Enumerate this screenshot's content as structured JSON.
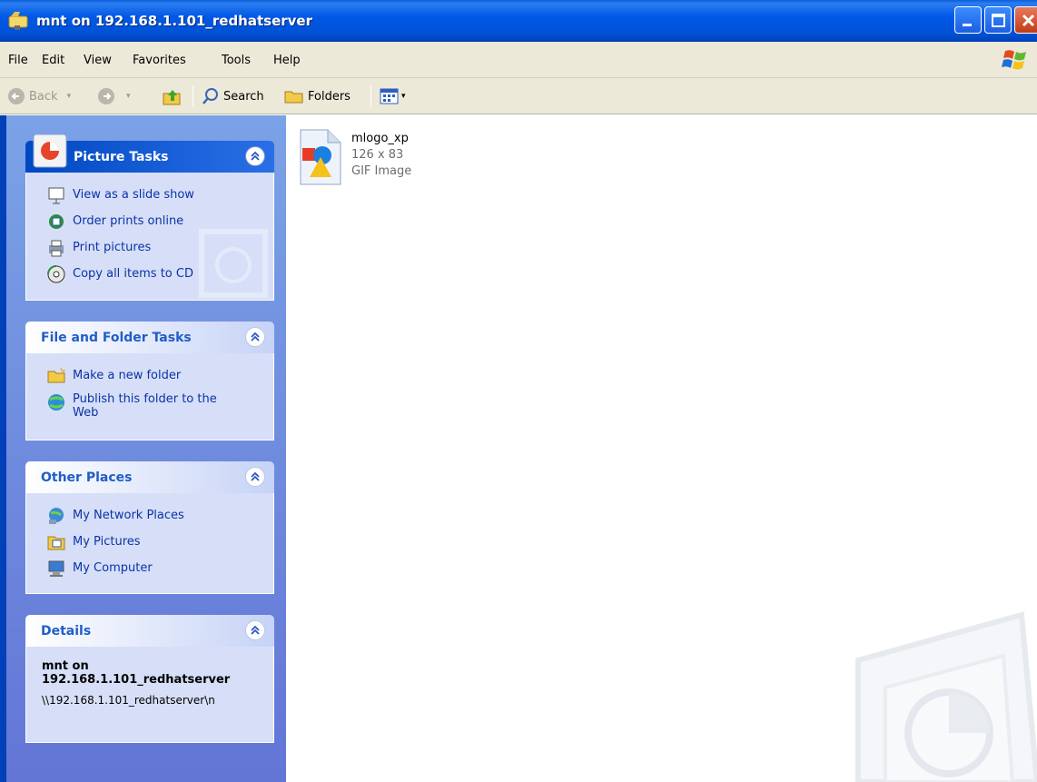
{
  "window": {
    "title": "mnt on 192.168.1.101_redhatserver"
  },
  "menu": [
    "File",
    "Edit",
    "View",
    "Favorites",
    "Tools",
    "Help"
  ],
  "toolbar": {
    "back": "Back",
    "search": "Search",
    "folders": "Folders"
  },
  "panels": {
    "picture_tasks": {
      "title": "Picture Tasks",
      "items": [
        "View as a slide show",
        "Order prints online",
        "Print pictures",
        "Copy all items to CD"
      ]
    },
    "file_folder_tasks": {
      "title": "File and Folder Tasks",
      "items": [
        "Make a new folder",
        "Publish this folder to the Web"
      ]
    },
    "other_places": {
      "title": "Other Places",
      "items": [
        "My Network Places",
        "My Pictures",
        "My Computer"
      ]
    },
    "details": {
      "title": "Details",
      "name": "mnt on 192.168.1.101_redhatserver",
      "path": "\\\\192.168.1.101_redhatserver\\n"
    }
  },
  "files": [
    {
      "name": "mlogo_xp",
      "dimensions": "126 x 83",
      "type": "GIF Image"
    }
  ],
  "colors": {
    "titlebar": "#0058e6",
    "taskpane": "#7ba2e7",
    "link": "#0c32a8",
    "panel_title": "#215dc6"
  }
}
